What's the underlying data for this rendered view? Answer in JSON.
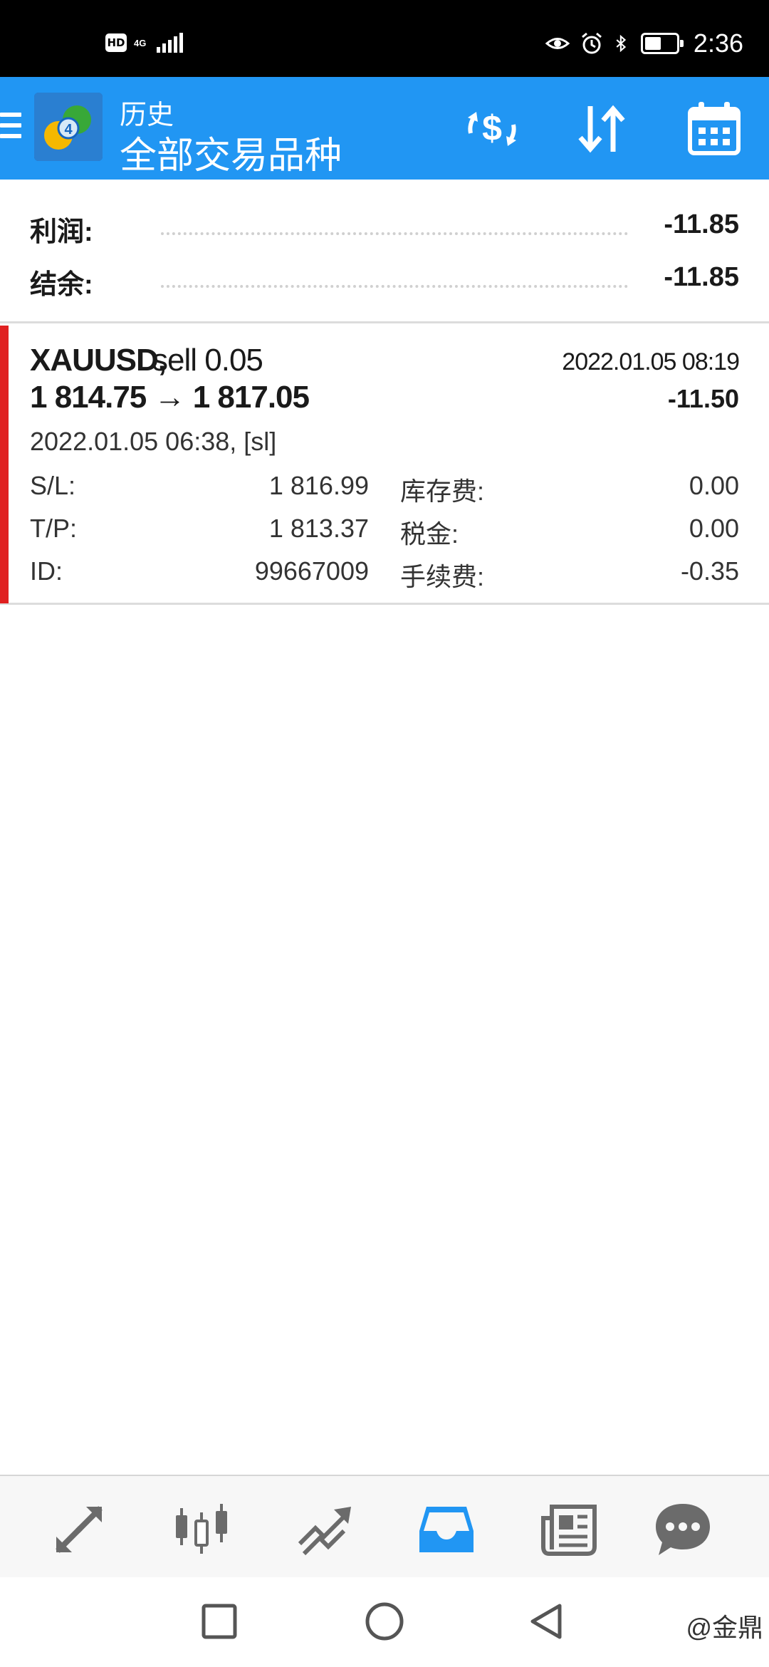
{
  "status_bar": {
    "hd": "HD",
    "network": "4G",
    "time": "2:36",
    "battery_level": 0.45,
    "icons": [
      "eye-icon",
      "alarm-icon",
      "bluetooth-icon",
      "battery-icon"
    ]
  },
  "app_bar": {
    "subtitle": "历史",
    "title": "全部交易品种",
    "accent": "#2196f3",
    "icons": [
      "menu-icon",
      "app-logo",
      "currency-exchange-icon",
      "sort-icon",
      "calendar-icon"
    ]
  },
  "summary": {
    "profit_label": "利润:",
    "profit_value": "-11.85",
    "balance_label": "结余:",
    "balance_value": "-11.85"
  },
  "trade": {
    "symbol": "XAUUSD,",
    "side": "sell 0.05",
    "close_time": "2022.01.05 08:19",
    "prices": "1 814.75 → 1 817.05",
    "profit": "-11.50",
    "open_time": "2022.01.05 06:38, [sl]",
    "indicator_color": "#e02020",
    "details": {
      "sl_label": "S/L:",
      "sl_value": "1 816.99",
      "tp_label": "T/P:",
      "tp_value": "1 813.37",
      "id_label": "ID:",
      "id_value": "99667009",
      "swap_label": "库存费:",
      "swap_value": "0.00",
      "tax_label": "税金:",
      "tax_value": "0.00",
      "commission_label": "手续费:",
      "commission_value": "-0.35"
    }
  },
  "bottom_nav": {
    "items": [
      "quotes-icon",
      "chart-icon",
      "trade-icon",
      "history-icon",
      "news-icon",
      "chat-icon"
    ],
    "active": "history-icon",
    "active_color": "#2196f3",
    "inactive_color": "#6b6b6b"
  },
  "system_nav": {
    "items": [
      "recents-square-icon",
      "home-circle-icon",
      "back-triangle-icon"
    ],
    "watermark": "@金鼎"
  }
}
